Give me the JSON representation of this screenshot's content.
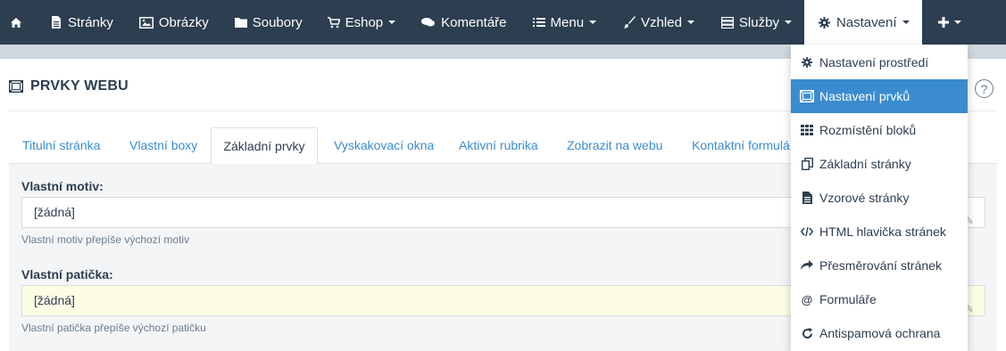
{
  "nav": {
    "home_icon": "home-icon",
    "items": [
      {
        "label": "Stránky",
        "icon": "file-icon"
      },
      {
        "label": "Obrázky",
        "icon": "image-icon"
      },
      {
        "label": "Soubory",
        "icon": "folder-icon"
      },
      {
        "label": "Eshop",
        "icon": "cart-icon"
      },
      {
        "label": "Komentáře",
        "icon": "comments-icon"
      },
      {
        "label": "Menu",
        "icon": "list-icon"
      },
      {
        "label": "Vzhled",
        "icon": "brush-icon"
      },
      {
        "label": "Služby",
        "icon": "server-icon"
      },
      {
        "label": "Nastavení",
        "icon": "gear-icon"
      }
    ],
    "plus_icon": "plus-icon",
    "colors": {
      "navbar": "#2c3e50",
      "accent": "#3a8ccf"
    }
  },
  "page": {
    "title": "PRVKY WEBU",
    "help_icon_glyph": "?"
  },
  "tabs": [
    {
      "label": "Titulní stránka"
    },
    {
      "label": "Vlastní boxy"
    },
    {
      "label": "Základní prvky"
    },
    {
      "label": "Vyskakovací okna"
    },
    {
      "label": "Aktivní rubrika"
    },
    {
      "label": "Zobrazit na webu"
    },
    {
      "label": "Kontaktní formulá"
    }
  ],
  "form": {
    "theme": {
      "label": "Vlastní motiv:",
      "value": "[žádná]",
      "help": "Vlastní motiv přepíše výchozí motiv"
    },
    "footer": {
      "label": "Vlastní patička:",
      "value": "[žádná]",
      "help": "Vlastní patička přepíše výchozí patičku"
    }
  },
  "dropdown": {
    "items": [
      {
        "label": "Nastavení prostředí",
        "icon": "gear-icon"
      },
      {
        "label": "Nastavení prvků",
        "icon": "elements-icon"
      },
      {
        "label": "Rozmístění bloků",
        "icon": "grid-icon"
      },
      {
        "label": "Základní stránky",
        "icon": "copy-icon"
      },
      {
        "label": "Vzorové stránky",
        "icon": "document-icon"
      },
      {
        "label": "HTML hlavička stránek",
        "icon": "code-icon"
      },
      {
        "label": "Přesměrování stránek",
        "icon": "share-icon"
      },
      {
        "label": "Formuláře",
        "icon": "at-icon"
      },
      {
        "label": "Antispamová ochrana",
        "icon": "refresh-icon"
      }
    ]
  }
}
